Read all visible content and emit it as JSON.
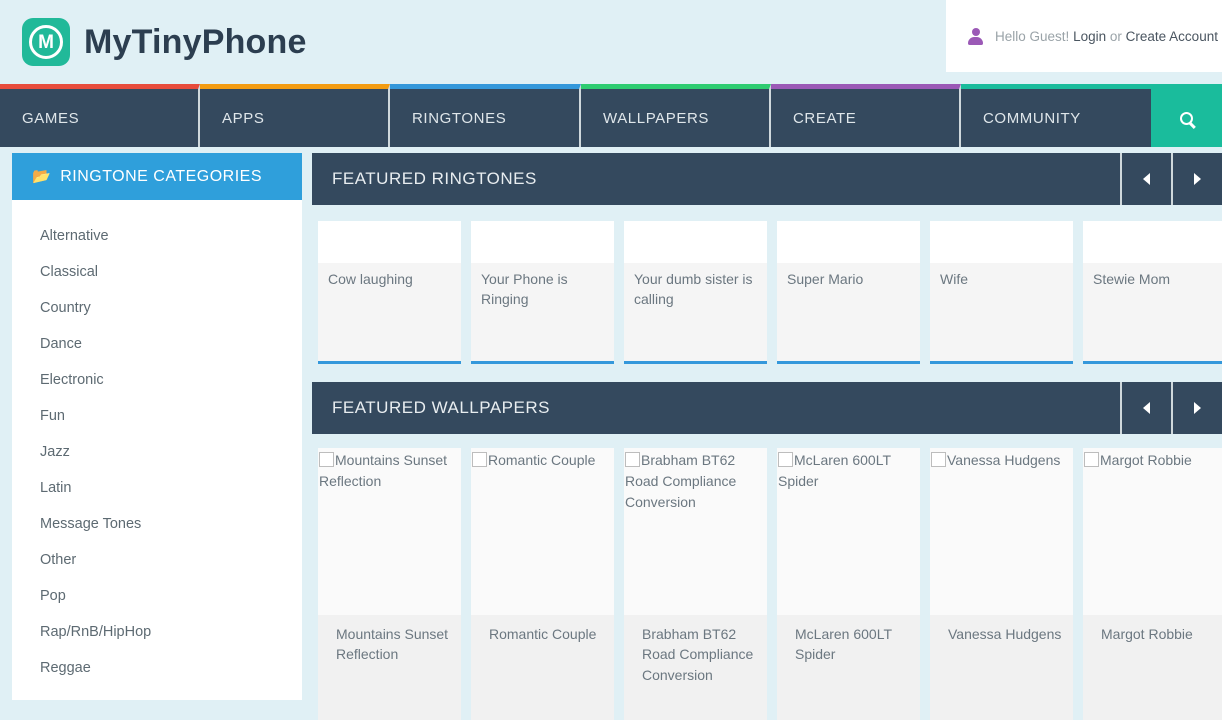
{
  "header": {
    "brand": "MyTinyPhone",
    "logo_letter": "M",
    "greeting": "Hello Guest!",
    "login_label": "Login",
    "or_label": "or",
    "create_account_label": "Create Account"
  },
  "nav": {
    "items": [
      {
        "label": "GAMES",
        "accent": "#e74c3c"
      },
      {
        "label": "APPS",
        "accent": "#f39c12"
      },
      {
        "label": "RINGTONES",
        "accent": "#3498db"
      },
      {
        "label": "WALLPAPERS",
        "accent": "#2ecc71"
      },
      {
        "label": "CREATE",
        "accent": "#9b59b6"
      },
      {
        "label": "COMMUNITY",
        "accent": "#1abc9c"
      }
    ],
    "search_icon": "search-icon"
  },
  "sidebar": {
    "title": "RINGTONE CATEGORIES",
    "icon": "folder-open-icon",
    "items": [
      {
        "label": "Alternative"
      },
      {
        "label": "Classical"
      },
      {
        "label": "Country"
      },
      {
        "label": "Dance"
      },
      {
        "label": "Electronic"
      },
      {
        "label": "Fun"
      },
      {
        "label": "Jazz"
      },
      {
        "label": "Latin"
      },
      {
        "label": "Message Tones"
      },
      {
        "label": "Other"
      },
      {
        "label": "Pop"
      },
      {
        "label": "Rap/RnB/HipHop"
      },
      {
        "label": "Reggae"
      }
    ]
  },
  "featured_ringtones": {
    "title": "FEATURED RINGTONES",
    "prev_icon": "arrow-left-icon",
    "next_icon": "arrow-right-icon",
    "accent": "#3498db",
    "items": [
      {
        "title": "Cow laughing"
      },
      {
        "title": "Your Phone is Ringing"
      },
      {
        "title": "Your dumb sister is calling"
      },
      {
        "title": "Super Mario"
      },
      {
        "title": "Wife"
      },
      {
        "title": "Stewie Mom"
      }
    ]
  },
  "featured_wallpapers": {
    "title": "FEATURED WALLPAPERS",
    "prev_icon": "arrow-left-icon",
    "next_icon": "arrow-right-icon",
    "accent": "#1abc9c",
    "items": [
      {
        "alt": "Mountains Sunset Reflection",
        "caption": "Mountains Sunset Reflection"
      },
      {
        "alt": "Romantic Couple",
        "caption": "Romantic Couple"
      },
      {
        "alt": "Brabham BT62 Road Compliance Conversion",
        "caption": "Brabham BT62 Road Compliance Conversion"
      },
      {
        "alt": "McLaren 600LT Spider",
        "caption": "McLaren 600LT Spider"
      },
      {
        "alt": "Vanessa Hudgens",
        "caption": "Vanessa Hudgens"
      },
      {
        "alt": "Margot Robbie",
        "caption": "Margot Robbie"
      }
    ]
  },
  "colors": {
    "page_background": "#e0f0f5",
    "navbar": "#34495e",
    "sidebar_header": "#2f9fdb",
    "brand_teal": "#21b999",
    "search_teal": "#1abc9c"
  }
}
